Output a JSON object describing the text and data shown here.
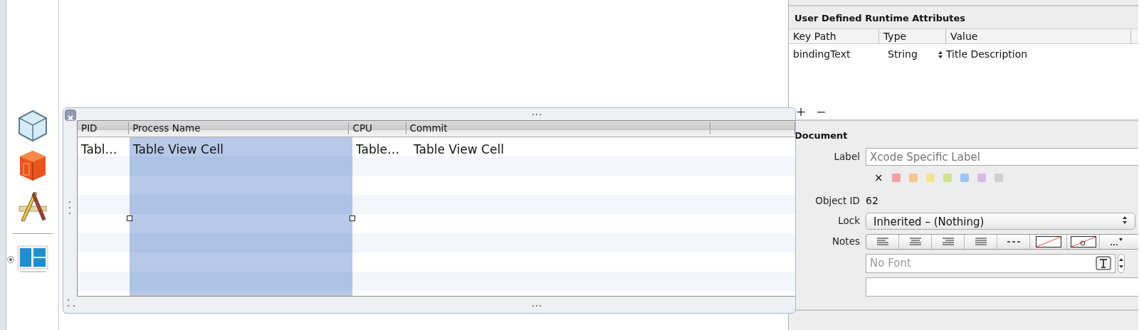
{
  "table": {
    "columns": [
      {
        "label": "PID",
        "selected": false
      },
      {
        "label": "Process Name",
        "selected": true
      },
      {
        "label": "CPU",
        "selected": false
      },
      {
        "label": "Commit",
        "selected": false
      }
    ],
    "rows": [
      [
        "Tabl…",
        "Table View Cell",
        "Table…",
        "Table View Cell"
      ]
    ]
  },
  "inspector": {
    "runtime_attributes": {
      "title": "User Defined Runtime Attributes",
      "columns": [
        "Key Path",
        "Type",
        "Value"
      ],
      "rows": [
        {
          "key_path": "bindingText",
          "type": "String",
          "value": "Title Description"
        }
      ],
      "add": "+",
      "remove": "−"
    },
    "document": {
      "title": "Document",
      "label_field": {
        "label": "Label",
        "placeholder": "Xcode Specific Label"
      },
      "clear_color": "×",
      "label_colors": [
        {
          "color": "#f4a0a0"
        },
        {
          "color": "#f7c68c"
        },
        {
          "color": "#f4e58a"
        },
        {
          "color": "#cde08e"
        },
        {
          "color": "#9cc6f2"
        },
        {
          "color": "#d8b9e6"
        },
        {
          "color": "#cfcfcf"
        }
      ],
      "object_id": {
        "label": "Object ID",
        "value": "62"
      },
      "lock": {
        "label": "Lock",
        "value": "Inherited – (Nothing)"
      },
      "notes": {
        "label": "Notes",
        "font_placeholder": "No Font"
      }
    }
  }
}
